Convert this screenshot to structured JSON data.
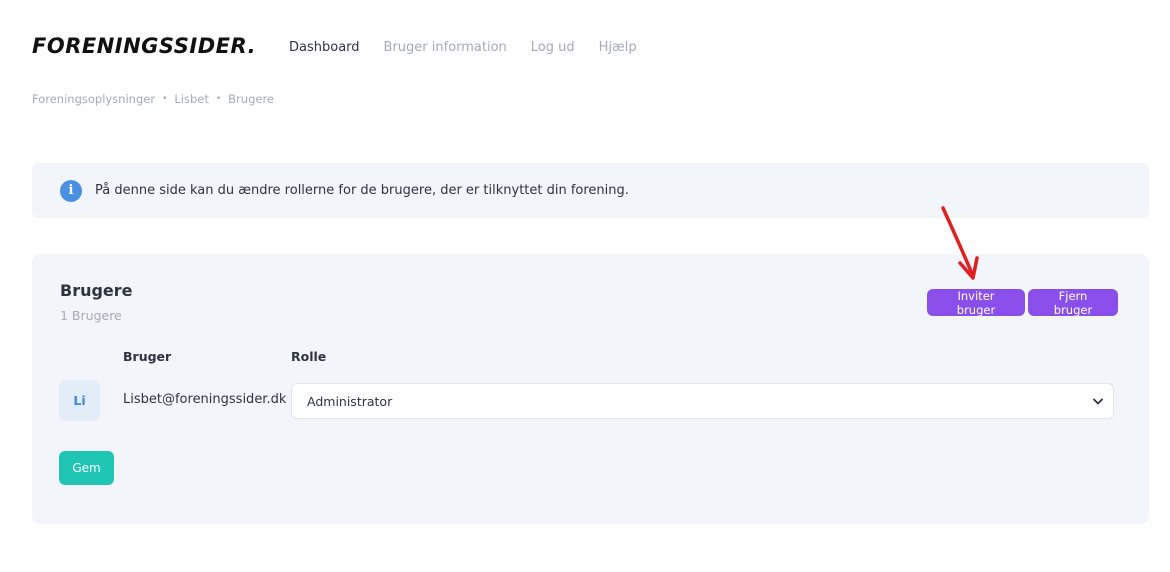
{
  "header": {
    "logo": "FORENINGSSIDER.",
    "nav": [
      "Dashboard",
      "Bruger information",
      "Log ud",
      "Hjælp"
    ]
  },
  "breadcrumb": [
    "Foreningsoplysninger",
    "Lisbet",
    "Brugere"
  ],
  "info": {
    "icon": "info-icon",
    "text": "På denne side kan du ændre rollerne for de brugere, der er tilknyttet din forening."
  },
  "users_card": {
    "title": "Brugere",
    "subtitle": "1 Brugere",
    "invite_label": "Inviter bruger",
    "remove_label": "Fjern bruger",
    "columns": {
      "user": "Bruger",
      "role": "Rolle"
    },
    "rows": [
      {
        "initials": "Li",
        "email": "Lisbet@foreningssider.dk",
        "role": "Administrator"
      }
    ],
    "save_label": "Gem"
  },
  "colors": {
    "accent_purple": "#8a4fea",
    "save_teal": "#1fc6b3",
    "info_blue": "#4a90e2",
    "annotation_red": "#e02020"
  }
}
